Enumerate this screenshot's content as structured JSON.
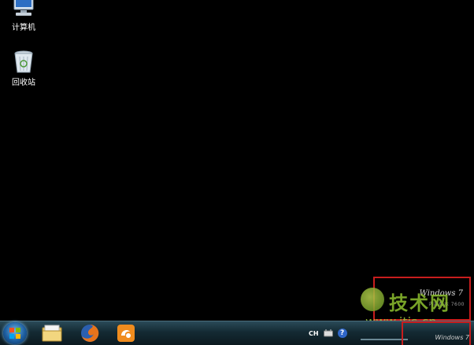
{
  "desktop": {
    "icons": [
      {
        "label": "计算机",
        "icon": "computer-icon"
      },
      {
        "label": "回收站",
        "icon": "recycle-bin-icon"
      }
    ]
  },
  "watermark": {
    "os_name": "Windows 7",
    "build_text": "内部版本 7600",
    "logo_text": "技术网",
    "logo_url": "www.itjs.cn"
  },
  "taskbar": {
    "start_icon": "windows-start-icon",
    "apps": [
      {
        "name": "explorer",
        "icon": "folder-library-icon"
      },
      {
        "name": "firefox",
        "icon": "firefox-icon"
      },
      {
        "name": "uc-browser",
        "icon": "uc-browser-icon"
      }
    ],
    "tray": {
      "language": "CH",
      "help_glyph": "?",
      "os_text": "Windows 7"
    }
  },
  "colors": {
    "desktop_bg": "#000000",
    "highlight_border": "#c81d1d",
    "logo_green": "#8fc12f"
  }
}
